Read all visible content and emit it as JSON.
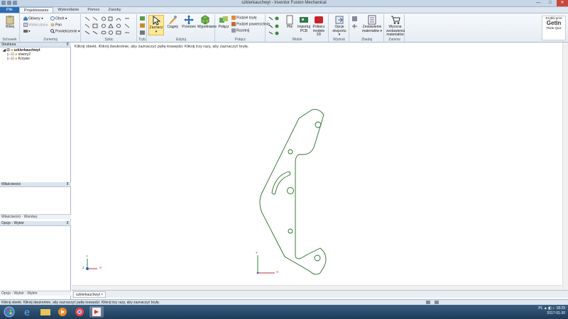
{
  "window": {
    "title": "szklerkauchwyt - Inventor Fusion Mechanical",
    "minimize": "—",
    "maximize": "□",
    "close": "✕"
  },
  "tabs": [
    "Plik",
    "Projektowanie",
    "Wykreślanie",
    "Pomoc",
    "Zasoby"
  ],
  "ribbon": {
    "groups": {
      "schowek": "Schowek",
      "zorientuj": "Zorientuj",
      "szkic": "Szkic",
      "tryb": "Tryb",
      "edytuj": "Edytuj",
      "polacz": "Połącz",
      "widok": "Widok",
      "wydruk": "Wydruk",
      "zbadaj": "Zbadaj",
      "zamow": "Zamów"
    },
    "schowek": {
      "paste": "Wklej"
    },
    "zorientuj": {
      "main_view": "Główny",
      "orbit": "Obrót",
      "view_plane": "Widok planu",
      "pan": "Pan",
      "zoom": "Powiększenie"
    },
    "tryb": {
      "select": "Zaznacz"
    },
    "edytuj": {
      "drag": "Ciągnij",
      "move": "Przenieś",
      "fill": "Wypełnianie"
    },
    "polacz": {
      "join": "Połącz",
      "split_body": "Podziel bryłę",
      "split_face": "Podziel powierzchnię",
      "cut": "Rozetnij"
    },
    "widok": {
      "file": "Plik",
      "import_pcb": "Importuj PCB",
      "view_3d": "Pobierz modele 3D"
    },
    "wydruk": {
      "export": "Opcje eksportu"
    },
    "zbadaj": {
      "bom": "Zestawienie materiałów"
    },
    "zamow": {
      "quote": "Wycena zestawienia materiałów"
    },
    "badge": {
      "line1": "Szybki prze",
      "line2": "GetIn",
      "line3": "Think Quiz"
    }
  },
  "left": {
    "structure_title": "Struktura",
    "tree": [
      "szklerkauchwyt",
      "otwory2",
      "Krzywe"
    ],
    "properties_title": "Właściwości",
    "properties_footer": "Właściwości · Warstwy",
    "options_title": "Opcje - Wybór",
    "options_footer": "Opcje - Wybór · Wybór",
    "pin": "⊼"
  },
  "canvas": {
    "hint": "Kliknij obiekt. Kliknij dwukrotnie, aby zaznaczyć pętlę krawędzi. Kliknij trzy razy, aby zaznaczyć bryłę.",
    "axis_x": "X",
    "axis_y": "Y",
    "axis_z": "Z"
  },
  "doc_tab": "szklerkauchwyt ×",
  "status_text": "Kliknij obiekt. Kliknij dwukrotnie, aby zaznaczyć pętlę krawędzi. Kliknij trzy razy, aby zaznaczyć bryłę.",
  "tray": {
    "lang": "PL",
    "time": "18:29",
    "date": "2017-01-30"
  },
  "colors": {
    "file_tab": "#2b6cb5",
    "outline": "#2a6a2a",
    "taskbar": "#2a4a6b"
  }
}
